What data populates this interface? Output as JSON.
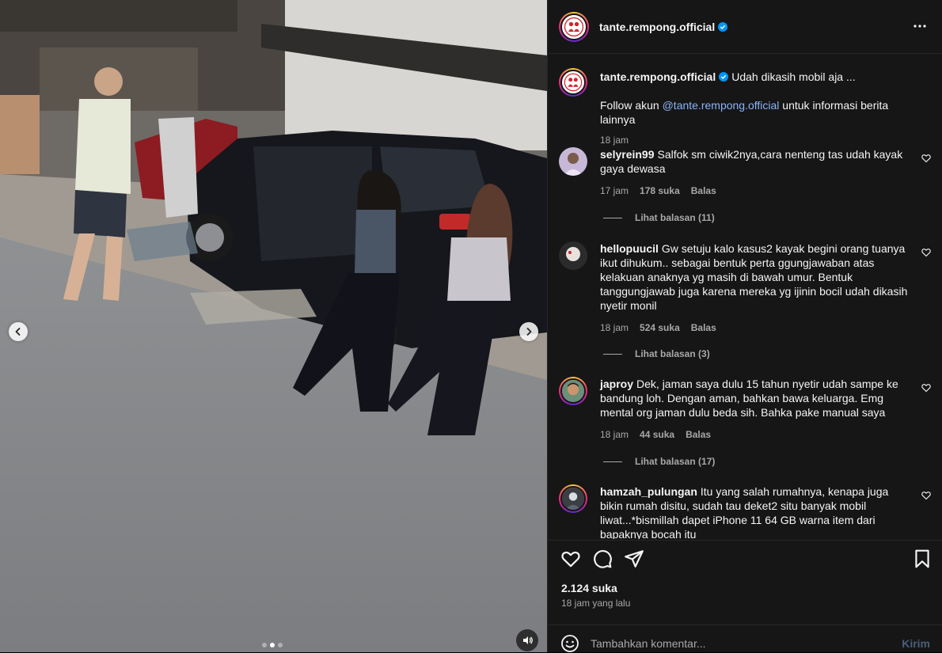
{
  "account": {
    "handle": "tante.rempong.official",
    "verified": true,
    "avatar_icon": "tante-rempong-logo-icon"
  },
  "media": {
    "prev_icon": "chevron-left-icon",
    "next_icon": "chevron-right-icon",
    "audio_icon": "speaker-icon",
    "carousel_total": 3,
    "carousel_active": 2
  },
  "caption": {
    "handle": "tante.rempong.official",
    "text": "Udah dikasih mobil aja ...",
    "follow_prefix": "Follow akun ",
    "follow_mention": "@tante.rempong.official",
    "follow_suffix": " untuk informasi berita lainnya",
    "time": "18 jam"
  },
  "comments": [
    {
      "user": "selyrein99",
      "text": "Salfok sm ciwik2nya,cara nenteng tas udah kayak gaya dewasa",
      "time": "17 jam",
      "likes": "178 suka",
      "reply_label": "Balas",
      "view_replies": "Lihat balasan (11)"
    },
    {
      "user": "hellopuucil",
      "text": "Gw setuju kalo kasus2 kayak begini orang tuanya ikut dihukum.. sebagai bentuk perta ggungjawaban atas kelakuan anaknya yg masih di bawah umur. Bentuk tanggungjawab juga karena mereka yg ijinin bocil udah dikasih nyetir monil",
      "time": "18 jam",
      "likes": "524 suka",
      "reply_label": "Balas",
      "view_replies": "Lihat balasan (3)"
    },
    {
      "user": "japroy",
      "text": "Dek, jaman saya dulu 15 tahun nyetir udah sampe ke bandung loh. Dengan aman, bahkan bawa keluarga. Emg mental org jaman dulu beda sih. Bahka pake manual saya",
      "time": "18 jam",
      "likes": "44 suka",
      "reply_label": "Balas",
      "view_replies": "Lihat balasan (17)"
    },
    {
      "user": "hamzah_pulungan",
      "text": "Itu yang salah rumahnya, kenapa juga bikin rumah disitu, sudah tau deket2 situ banyak mobil liwat...*bismillah dapet iPhone 11 64 GB warna item dari bapaknya bocah itu",
      "time": "",
      "likes": "",
      "reply_label": "",
      "view_replies": ""
    }
  ],
  "actions": {
    "like_icon": "heart-icon",
    "comment_icon": "comment-bubble-icon",
    "share_icon": "paper-plane-icon",
    "save_icon": "bookmark-icon",
    "likes_count": "2.124 suka",
    "posted_time": "18 jam yang lalu"
  },
  "comment_box": {
    "emoji_icon": "emoji-smile-icon",
    "placeholder": "Tambahkan komentar...",
    "post_label": "Kirim"
  },
  "colors": {
    "panel_bg": "#161616",
    "text_primary": "#f5f5f5",
    "text_secondary": "#a8a8a8",
    "verified_blue": "#0095f6",
    "link_blue": "#8ab4f8"
  }
}
